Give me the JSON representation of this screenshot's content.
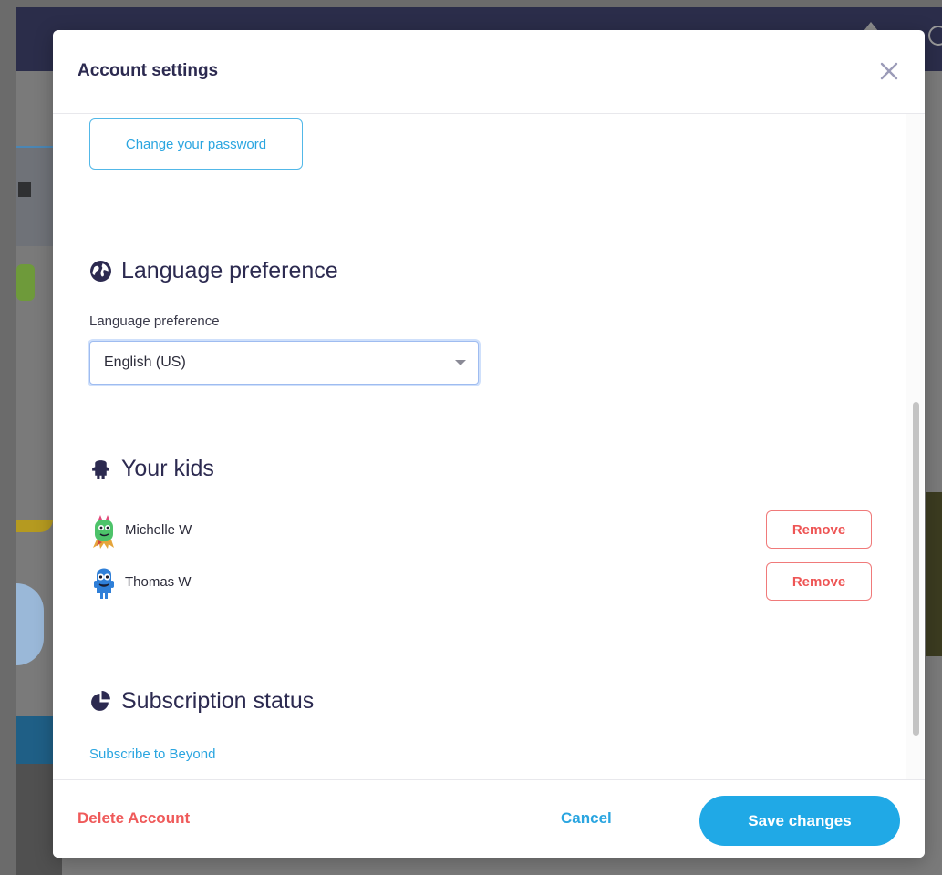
{
  "modal": {
    "title": "Account settings",
    "close_icon": "close-icon"
  },
  "password": {
    "button_label": "Change your password"
  },
  "language": {
    "heading": "Language preference",
    "heading_icon": "globe-icon",
    "field_label": "Language preference",
    "selected_value": "English (US)"
  },
  "kids": {
    "heading": "Your kids",
    "heading_icon": "monster-icon",
    "items": [
      {
        "name": "Michelle W",
        "avatar": "green-monster-avatar",
        "remove_label": "Remove"
      },
      {
        "name": "Thomas W",
        "avatar": "blue-monster-avatar",
        "remove_label": "Remove"
      }
    ]
  },
  "subscription": {
    "heading": "Subscription status",
    "heading_icon": "pie-chart-icon",
    "link_label": "Subscribe to Beyond"
  },
  "footer": {
    "delete_label": "Delete Account",
    "cancel_label": "Cancel",
    "save_label": "Save changes"
  },
  "colors": {
    "accent_blue": "#20a9e6",
    "danger_red": "#ef5a5a",
    "heading_navy": "#2c2a50"
  }
}
